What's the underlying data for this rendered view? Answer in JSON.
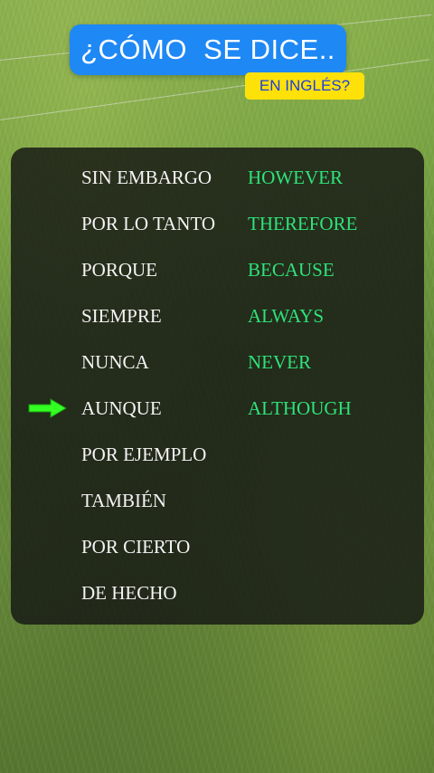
{
  "header": {
    "title": "¿CÓMO  SE DICE..",
    "subtitle": "EN INGLÉS?"
  },
  "colors": {
    "title_bg": "#1e88f5",
    "subtitle_bg": "#ffe10a",
    "subtitle_text": "#1b3fe0",
    "english_text": "#2ee27a",
    "arrow": "#33ff22"
  },
  "pointer_icon": "right-arrow-icon",
  "current_row": 5,
  "rows": [
    {
      "es": "SIN EMBARGO",
      "en": "HOWEVER"
    },
    {
      "es": "POR LO TANTO",
      "en": "THEREFORE"
    },
    {
      "es": "PORQUE",
      "en": "BECAUSE"
    },
    {
      "es": "SIEMPRE",
      "en": "ALWAYS"
    },
    {
      "es": "NUNCA",
      "en": "NEVER"
    },
    {
      "es": "AUNQUE",
      "en": "ALTHOUGH"
    },
    {
      "es": "POR EJEMPLO",
      "en": ""
    },
    {
      "es": "TAMBIÉN",
      "en": ""
    },
    {
      "es": "POR CIERTO",
      "en": ""
    },
    {
      "es": "DE HECHO",
      "en": ""
    }
  ]
}
